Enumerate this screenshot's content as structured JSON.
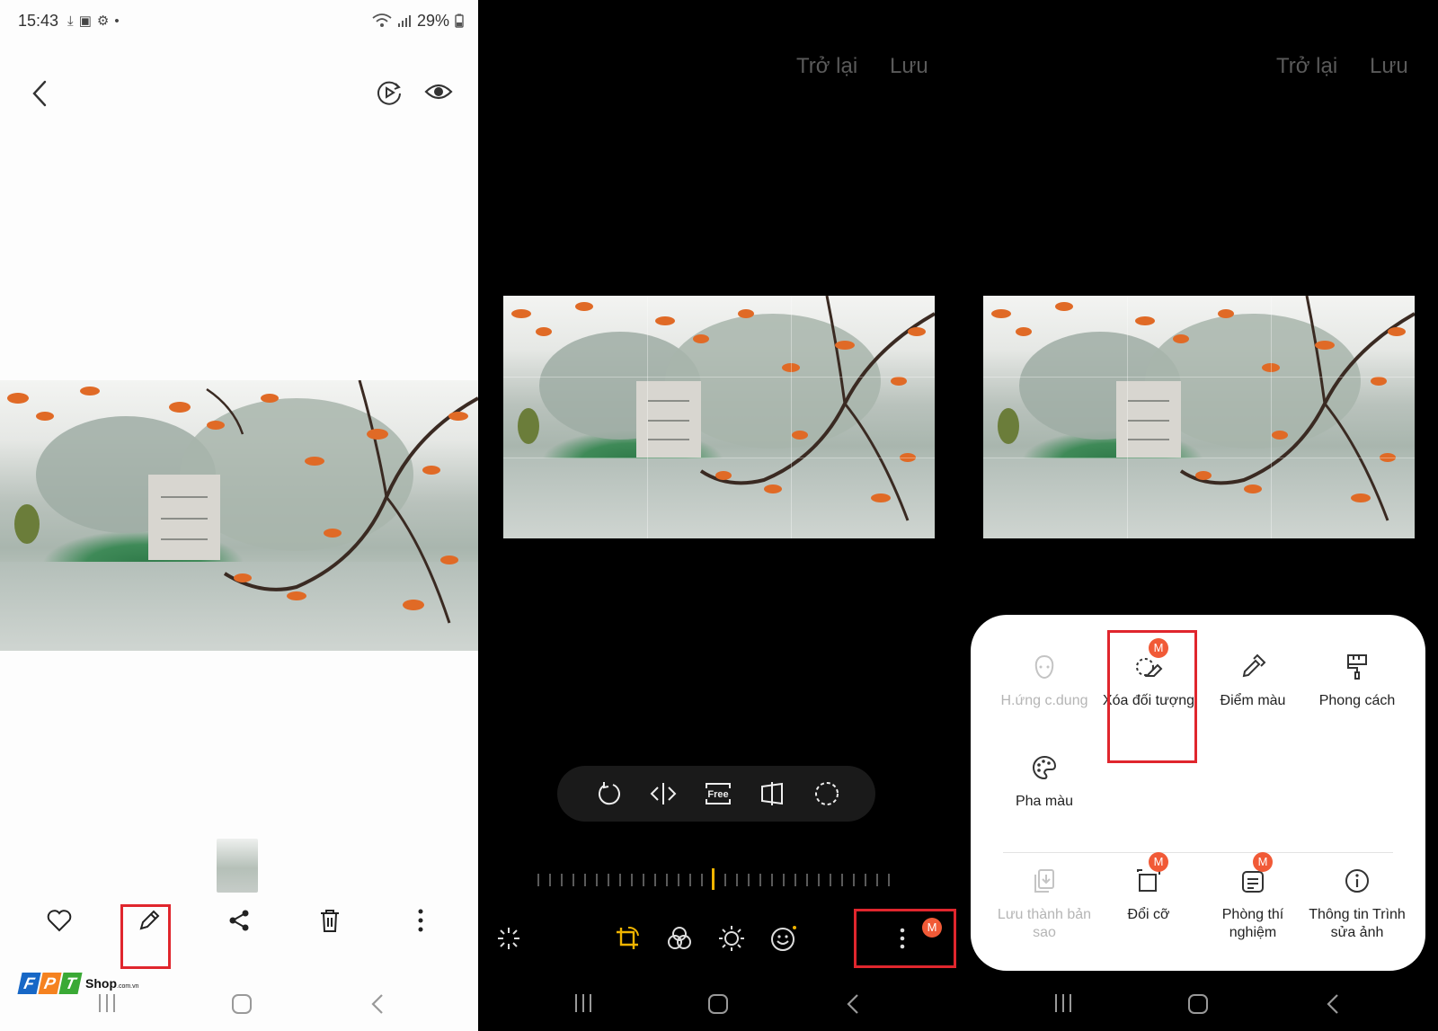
{
  "panel1": {
    "status": {
      "time": "15:43",
      "battery": "29%"
    },
    "icons": {
      "back": "back-arrow-icon",
      "motion": "motion-photo-icon",
      "view": "eye-icon"
    },
    "actions": [
      "heart-icon",
      "pencil-icon",
      "share-icon",
      "trash-icon",
      "more-vertical-icon"
    ],
    "logo": {
      "letters": [
        "F",
        "P",
        "T"
      ],
      "shop": "Shop",
      "domain": ".com.vn",
      "colors": [
        "#1767c6",
        "#f58220",
        "#3aa935"
      ]
    }
  },
  "panel2": {
    "back_label": "Trở lại",
    "save_label": "Lưu",
    "tools": [
      "rotate-icon",
      "flip-icon",
      "free-crop-icon",
      "perspective-icon",
      "lasso-icon"
    ],
    "free_text": "Free",
    "bottom_tools": [
      "auto-enhance-icon",
      "crop-rotate-icon",
      "filter-icon",
      "brightness-icon",
      "sticker-icon",
      "more-vertical-icon"
    ],
    "badge": "M",
    "accent": "#f0b400"
  },
  "panel3": {
    "back_label": "Trở lại",
    "save_label": "Lưu",
    "menu": [
      {
        "label": "H.ứng c.dung",
        "icon": "face-effect-icon",
        "disabled": true,
        "badge": ""
      },
      {
        "label": "Xóa đối tượng",
        "icon": "object-eraser-icon",
        "disabled": false,
        "badge": "M"
      },
      {
        "label": "Điểm màu",
        "icon": "color-picker-icon",
        "disabled": false,
        "badge": ""
      },
      {
        "label": "Phong cách",
        "icon": "style-brush-icon",
        "disabled": false,
        "badge": ""
      },
      {
        "label": "Pha màu",
        "icon": "palette-icon",
        "disabled": false,
        "badge": ""
      },
      {
        "label": "Lưu thành bản sao",
        "icon": "save-copy-icon",
        "disabled": true,
        "badge": ""
      },
      {
        "label": "Đổi cỡ",
        "icon": "resize-icon",
        "disabled": false,
        "badge": "M"
      },
      {
        "label": "Phòng thí nghiệm",
        "icon": "labs-icon",
        "disabled": false,
        "badge": "M"
      },
      {
        "label": "Thông tin Trình sửa ảnh",
        "icon": "info-icon",
        "disabled": false,
        "badge": ""
      }
    ]
  },
  "highlight_color": "#e0262d",
  "badge_color": "#f15a37"
}
